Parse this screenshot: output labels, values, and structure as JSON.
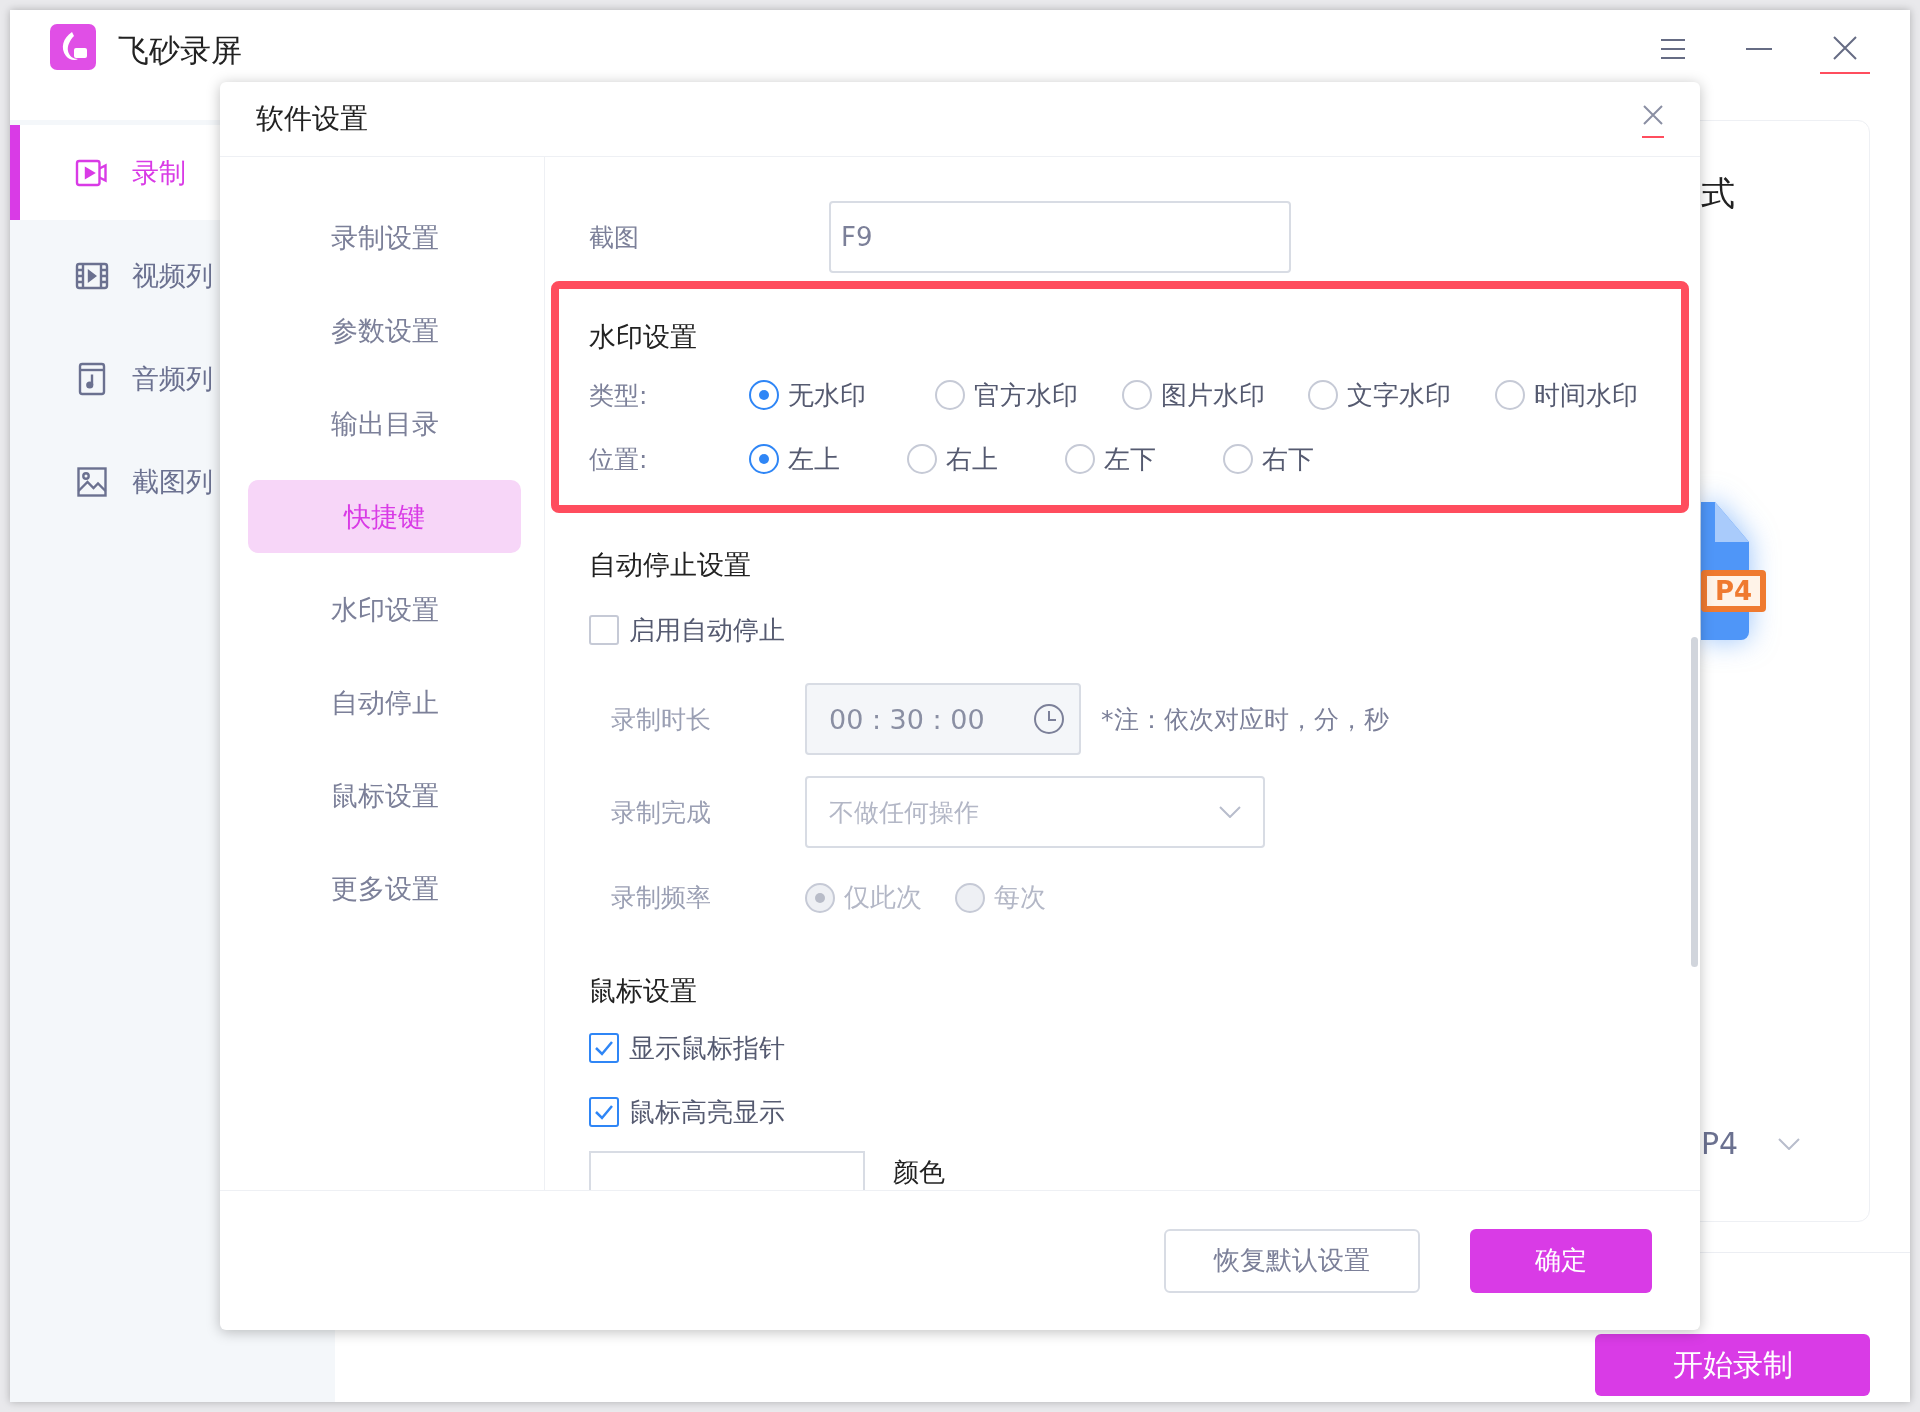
{
  "app": {
    "title": "飞砂录屏"
  },
  "sidebar": {
    "items": [
      {
        "label": "录制",
        "selected": true
      },
      {
        "label": "视频列",
        "selected": false
      },
      {
        "label": "音频列",
        "selected": false
      },
      {
        "label": "截图列",
        "selected": false
      }
    ]
  },
  "format_panel": {
    "title": "式",
    "file_badge": "P4",
    "format_value": "P4"
  },
  "start_button": "开始录制",
  "dialog": {
    "title": "软件设置",
    "nav": [
      {
        "label": "录制设置",
        "selected": false
      },
      {
        "label": "参数设置",
        "selected": false
      },
      {
        "label": "输出目录",
        "selected": false
      },
      {
        "label": "快捷键",
        "selected": true
      },
      {
        "label": "水印设置",
        "selected": false
      },
      {
        "label": "自动停止",
        "selected": false
      },
      {
        "label": "鼠标设置",
        "selected": false
      },
      {
        "label": "更多设置",
        "selected": false
      }
    ],
    "hotkey": {
      "label": "截图",
      "value": "F9"
    },
    "watermark": {
      "title": "水印设置",
      "highlighted": true,
      "type_label": "类型:",
      "types": [
        {
          "label": "无水印",
          "selected": true
        },
        {
          "label": "官方水印",
          "selected": false
        },
        {
          "label": "图片水印",
          "selected": false
        },
        {
          "label": "文字水印",
          "selected": false
        },
        {
          "label": "时间水印",
          "selected": false
        }
      ],
      "position_label": "位置:",
      "positions": [
        {
          "label": "左上",
          "selected": true
        },
        {
          "label": "右上",
          "selected": false
        },
        {
          "label": "左下",
          "selected": false
        },
        {
          "label": "右下",
          "selected": false
        }
      ]
    },
    "auto_stop": {
      "title": "自动停止设置",
      "enable": {
        "label": "启用自动停止",
        "checked": false
      },
      "duration_label": "录制时长",
      "duration": "00 : 30 : 00",
      "note": "*注：依次对应时，分，秒",
      "finish_label": "录制完成",
      "finish_value": "不做任何操作",
      "frequency_label": "录制频率",
      "frequency": [
        {
          "label": "仅此次",
          "selected": true
        },
        {
          "label": "每次",
          "selected": false
        }
      ]
    },
    "mouse": {
      "title": "鼠标设置",
      "options": [
        {
          "label": "显示鼠标指针",
          "checked": true
        },
        {
          "label": "鼠标高亮显示",
          "checked": true
        }
      ],
      "color_label": "颜色"
    },
    "buttons": {
      "reset": "恢复默认设置",
      "confirm": "确定"
    }
  }
}
